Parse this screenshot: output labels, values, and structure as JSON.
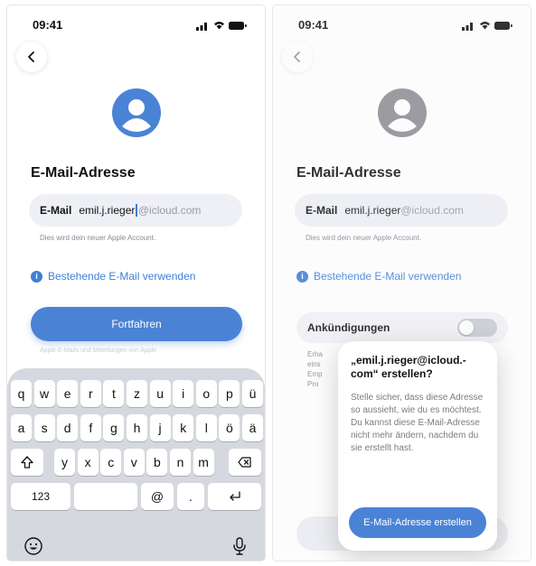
{
  "left": {
    "status": {
      "time": "09:41"
    },
    "heading": "E-Mail-Adresse",
    "email": {
      "label": "E-Mail",
      "user": "emil.j.rieger",
      "domain": "@icloud.com"
    },
    "hint": "Dies wird dein neuer Apple Account.",
    "link": "Bestehende E-Mail verwenden",
    "continue": "Fortfahren",
    "faded": "Apple E-Mails und Mitteilungen von Apple",
    "keyboard": {
      "row1": [
        "q",
        "w",
        "e",
        "r",
        "t",
        "z",
        "u",
        "i",
        "o",
        "p",
        "ü"
      ],
      "row2": [
        "a",
        "s",
        "d",
        "f",
        "g",
        "h",
        "j",
        "k",
        "l",
        "ö",
        "ä"
      ],
      "row3": [
        "y",
        "x",
        "c",
        "v",
        "b",
        "n",
        "m"
      ],
      "numbers": "123",
      "at": "@",
      "dot": "."
    }
  },
  "right": {
    "status": {
      "time": "09:41"
    },
    "heading": "E-Mail-Adresse",
    "email": {
      "label": "E-Mail",
      "user": "emil.j.rieger",
      "domain": "@icloud.com"
    },
    "hint": "Dies wird dein neuer Apple Account.",
    "link": "Bestehende E-Mail verwenden",
    "announcements": "Ankündigungen",
    "detail_lines": [
      "Erha",
      "eins",
      "Emp",
      "Pro"
    ],
    "popover": {
      "title_line1": "„emil.j.rieger@icloud.-",
      "title_line2": "com“ erstellen?",
      "body": "Stelle sicher, dass diese Adresse so aussieht, wie du es möchtest. Du kannst diese E-Mail-Adresse nicht mehr ändern, nachdem du sie erstellt hast.",
      "button": "E-Mail-Adresse erstellen"
    }
  },
  "colors": {
    "accent": "#4a83d6",
    "link": "#3f7fd6",
    "keyboard_bg": "#d5d8de",
    "avatar_blue": "#4a83d6",
    "avatar_gray": "#8e8e93"
  },
  "icons": [
    "chevron-left-icon",
    "person-icon",
    "info-icon",
    "shift-icon",
    "backspace-icon",
    "return-icon",
    "emoji-icon",
    "microphone-icon",
    "signal-icon",
    "wifi-icon",
    "battery-icon"
  ]
}
